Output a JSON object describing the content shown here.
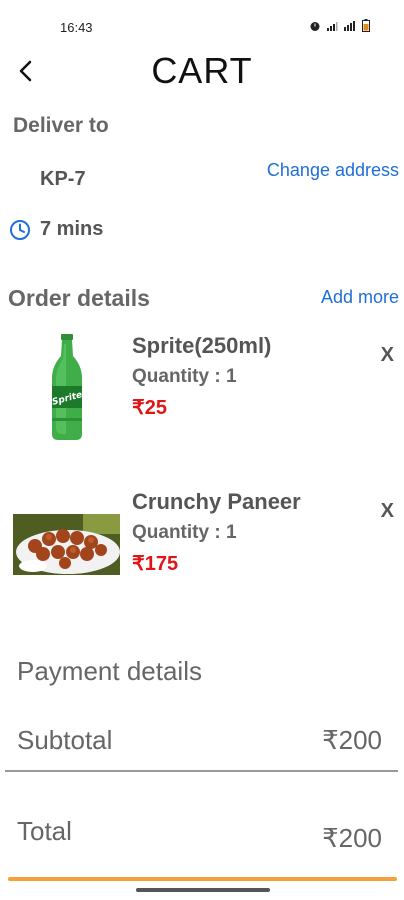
{
  "status_bar": {
    "time": "16:43",
    "icons": [
      "alarm-icon",
      "signal-icon",
      "wifi-icon",
      "battery-icon"
    ]
  },
  "header": {
    "title": "CART",
    "back_icon": "back-arrow-icon"
  },
  "delivery": {
    "label": "Deliver to",
    "address": "KP-7",
    "change_label": "Change address",
    "eta": "7 mins"
  },
  "order": {
    "label": "Order details",
    "add_more": "Add more",
    "items": [
      {
        "name": "Sprite(250ml)",
        "quantity": "Quantity : 1",
        "price": "₹25",
        "remove": "X"
      },
      {
        "name": "Crunchy Paneer",
        "quantity": "Quantity : 1",
        "price": "₹175",
        "remove": "X"
      }
    ]
  },
  "payment": {
    "label": "Payment details",
    "subtotal_label": "Subtotal",
    "subtotal_value": "₹200",
    "total_label": "Total",
    "total_value": "₹200"
  },
  "colors": {
    "link": "#1f6fd6",
    "price": "#e01616",
    "accent": "#f5a03a"
  }
}
